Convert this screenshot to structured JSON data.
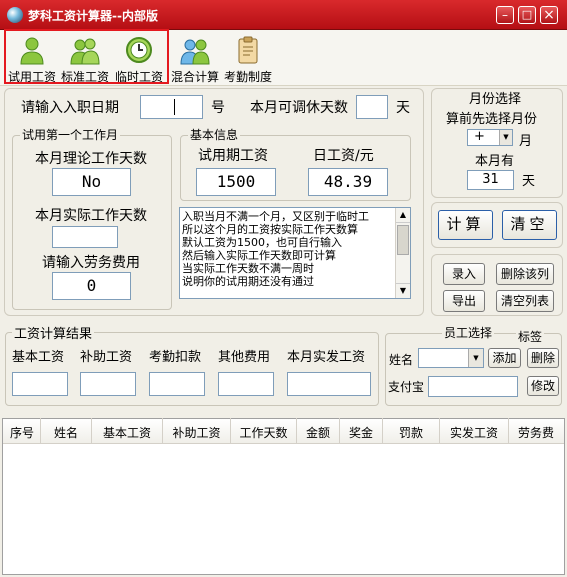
{
  "window": {
    "title": "梦科工资计算器--内部版",
    "min": "–",
    "max": "□",
    "close": "×"
  },
  "toolbar": [
    {
      "label": "试用工资"
    },
    {
      "label": "标准工资"
    },
    {
      "label": "临时工资"
    },
    {
      "label": "混合计算"
    },
    {
      "label": "考勤制度"
    }
  ],
  "entry": {
    "date_label": "请输入入职日期",
    "date_value": "",
    "date_unit": "号",
    "leave_label": "本月可调休天数",
    "leave_value": "",
    "leave_unit": "天"
  },
  "trial_month": {
    "group": "试用第一个工作月",
    "theory_label": "本月理论工作天数",
    "theory_value": "No",
    "actual_label": "本月实际工作天数",
    "actual_value": "",
    "labor_label": "请输入劳务费用",
    "labor_value": "0"
  },
  "basic_info": {
    "group": "基本信息",
    "trial_salary_label": "试用期工资",
    "trial_salary_value": "1500",
    "daily_label": "日工资/元",
    "daily_value": "48.39"
  },
  "notes": [
    "入职当月不满一个月，又区别于临时工",
    "所以这个月的工资按实际工作天数算",
    "默认工资为1500，也可自行输入",
    "然后输入实际工作天数即可计算",
    "当实际工作天数不满一周时",
    "说明你的试用期还没有通过"
  ],
  "month_select": {
    "title": "月份选择",
    "hint": "算前先选择月份",
    "month_value": "+",
    "month_unit": "月",
    "days_label": "本月有",
    "days_value": "31",
    "days_unit": "天"
  },
  "actions": {
    "calc": "计算",
    "clear": "清空"
  },
  "records": {
    "add": "录入",
    "delete_row": "删除该列",
    "export": "导出",
    "clear_list": "清空列表"
  },
  "result": {
    "group": "工资计算结果",
    "fields": [
      {
        "label": "基本工资",
        "value": ""
      },
      {
        "label": "补助工资",
        "value": ""
      },
      {
        "label": "考勤扣款",
        "value": ""
      },
      {
        "label": "其他费用",
        "value": ""
      },
      {
        "label": "本月实发工资",
        "value": ""
      }
    ]
  },
  "employee": {
    "group": "员工选择",
    "tag_label": "标签",
    "name_label": "姓名",
    "name_value": "",
    "add": "添加",
    "delete": "删除",
    "alipay_label": "支付宝",
    "alipay_value": "",
    "edit": "修改"
  },
  "table": {
    "columns": [
      "序号",
      "姓名",
      "基本工资",
      "补助工资",
      "工作天数",
      "金额",
      "奖金",
      "罚款",
      "实发工资",
      "劳务费"
    ],
    "rows": []
  },
  "colors": {
    "titlebar": "#c81b1f",
    "highlight": "#e4191f",
    "input_border": "#7f9db9"
  }
}
